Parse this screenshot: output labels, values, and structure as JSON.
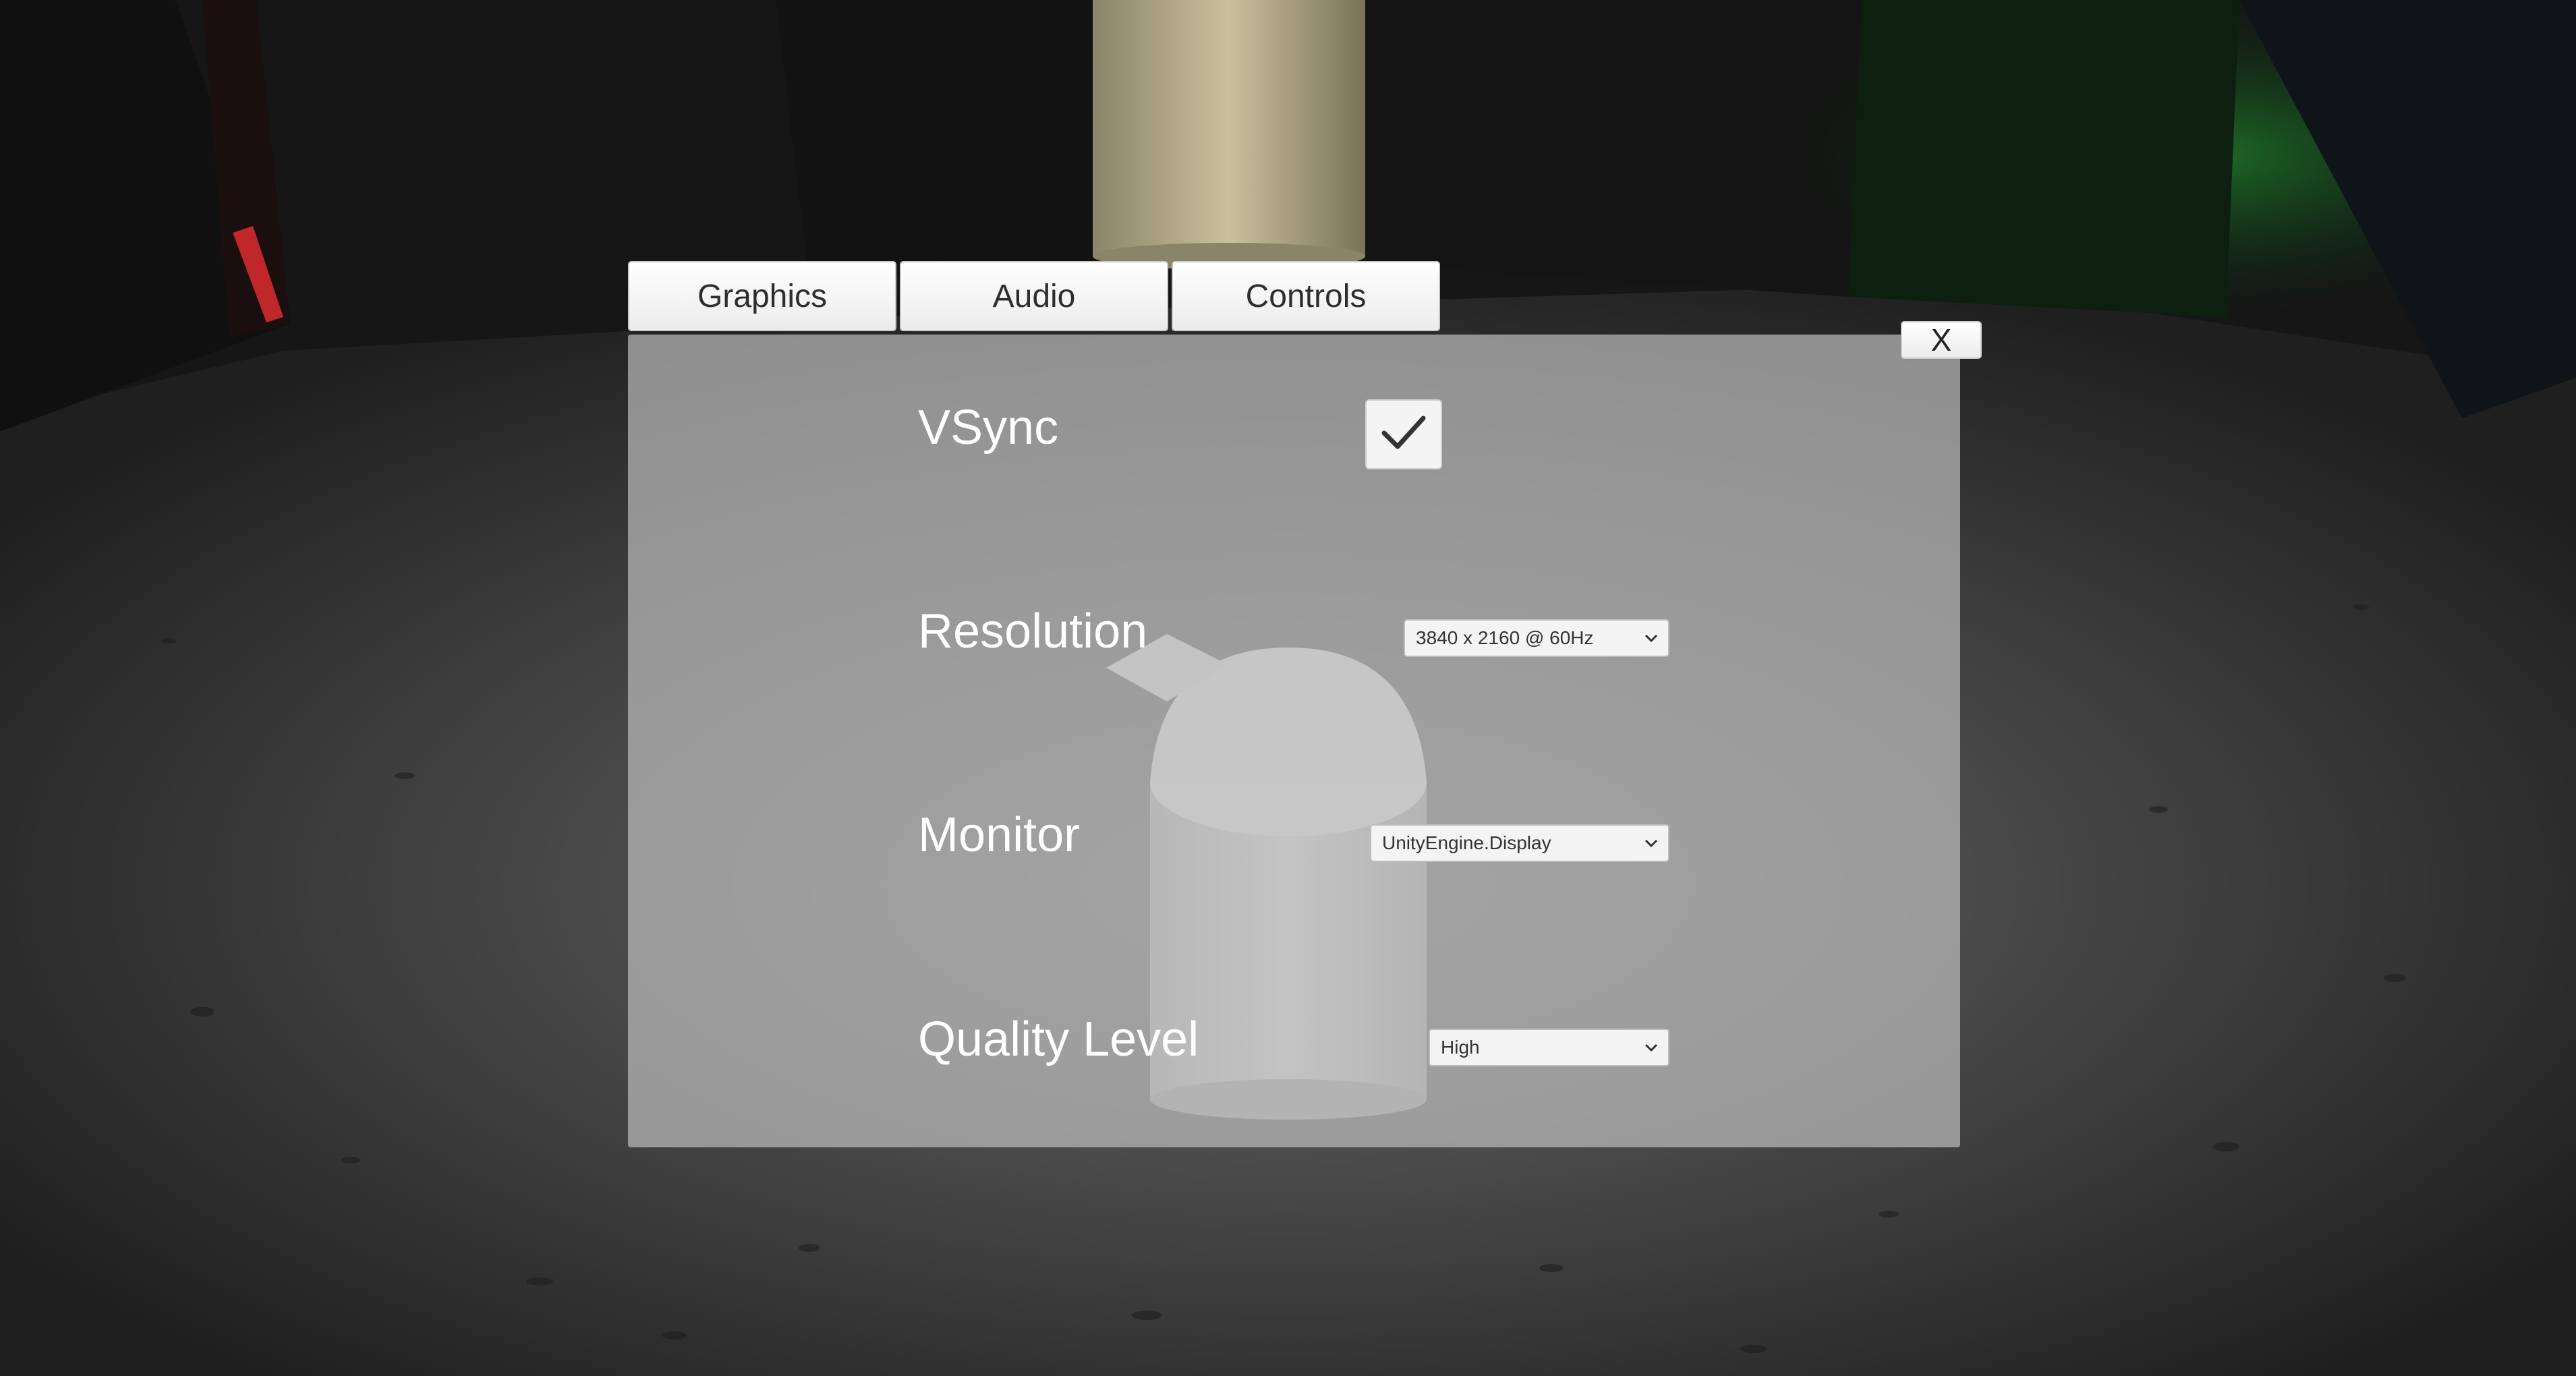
{
  "tabs": [
    {
      "label": "Graphics"
    },
    {
      "label": "Audio"
    },
    {
      "label": "Controls"
    }
  ],
  "close_button": {
    "label": "X"
  },
  "settings": {
    "vsync": {
      "label": "VSync",
      "checked": true
    },
    "resolution": {
      "label": "Resolution",
      "selected": "3840 x 2160 @ 60Hz"
    },
    "monitor": {
      "label": "Monitor",
      "selected": "UnityEngine.Display"
    },
    "quality": {
      "label": "Quality Level",
      "selected": "High"
    }
  },
  "icons": {
    "vsync_check": "checkmark-icon",
    "dropdown_arrow": "chevron-down-icon"
  },
  "colors": {
    "panel": "#bebebe",
    "tab_background": "#ffffff",
    "label_text": "#ffffff"
  }
}
